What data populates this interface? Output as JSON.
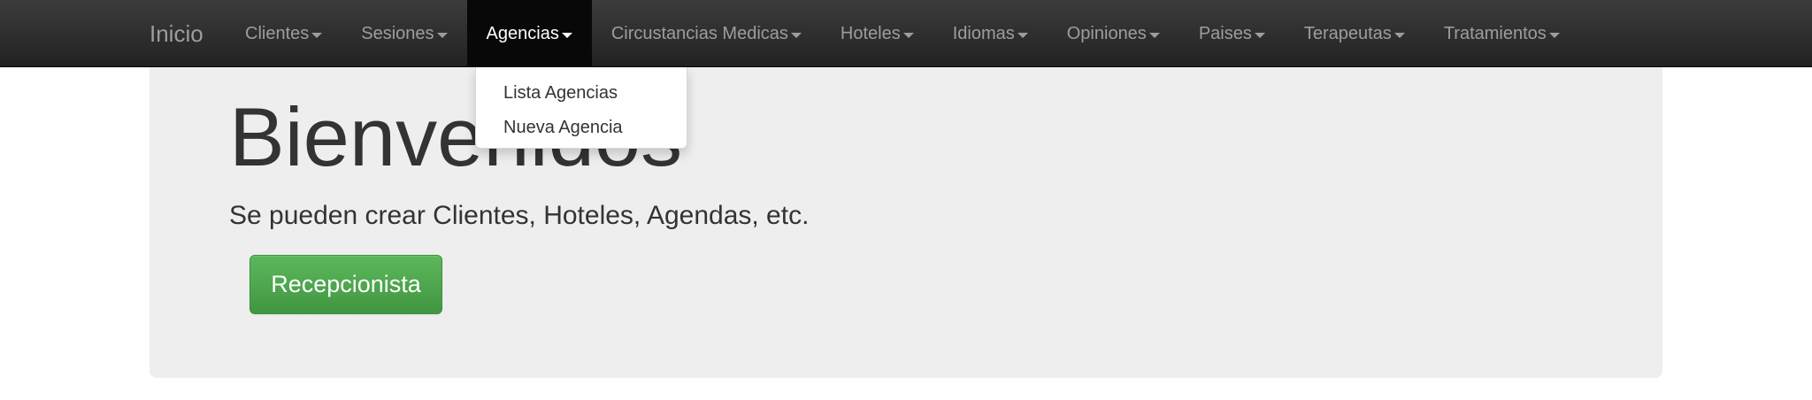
{
  "navbar": {
    "brand": "Inicio",
    "items": [
      {
        "label": "Clientes",
        "active": false
      },
      {
        "label": "Sesiones",
        "active": false
      },
      {
        "label": "Agencias",
        "active": true
      },
      {
        "label": "Circustancias Medicas",
        "active": false
      },
      {
        "label": "Hoteles",
        "active": false
      },
      {
        "label": "Idiomas",
        "active": false
      },
      {
        "label": "Opiniones",
        "active": false
      },
      {
        "label": "Paises",
        "active": false
      },
      {
        "label": "Terapeutas",
        "active": false
      },
      {
        "label": "Tratamientos",
        "active": false
      }
    ],
    "caret_icon": "caret-down-icon"
  },
  "dropdown": {
    "items": [
      "Lista Agencias",
      "Nueva Agencia"
    ]
  },
  "jumbotron": {
    "title": "Bienvenidos",
    "lead": "Se pueden crear Clientes, Hoteles, Agendas, etc.",
    "button_label": "Recepcionista"
  },
  "colors": {
    "navbar_bg": "#222222",
    "navbar_text": "#9d9d9d",
    "active_bg": "#080808",
    "jumbotron_bg": "#eeeeee",
    "success": "#5cb85c"
  }
}
